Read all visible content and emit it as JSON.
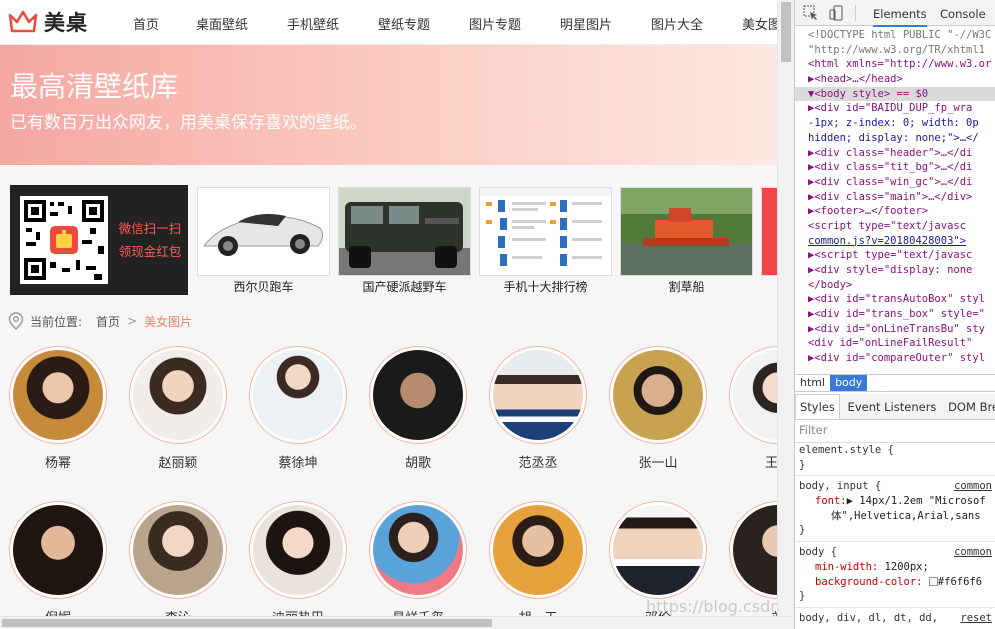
{
  "site": {
    "logo_text": "美桌",
    "nav": [
      "首页",
      "桌面壁纸",
      "手机壁纸",
      "壁纸专题",
      "图片专题",
      "明星图片",
      "图片大全",
      "美女图"
    ],
    "banner": {
      "title": "最高清壁纸库",
      "subtitle": "已有数百万出众网友，用美桌保存喜欢的壁纸。"
    },
    "promo": {
      "line1": "微信扫一扫",
      "line2": "领现金红包"
    },
    "thumbs": [
      {
        "caption": "西尔贝跑车",
        "icon": "sports-car-image"
      },
      {
        "caption": "国产硬派越野车",
        "icon": "offroad-vehicle-image"
      },
      {
        "caption": "手机十大排行榜",
        "icon": "phone-ranking-image"
      },
      {
        "caption": "割草船",
        "icon": "weed-boat-image"
      }
    ],
    "breadcrumb": {
      "label": "当前位置:",
      "home": "首页",
      "sep": ">",
      "current": "美女图片"
    },
    "celebrities": [
      {
        "name": "杨幂"
      },
      {
        "name": "赵丽颖"
      },
      {
        "name": "蔡徐坤"
      },
      {
        "name": "胡歌"
      },
      {
        "name": "范丞丞"
      },
      {
        "name": "张一山"
      },
      {
        "name": "王俊"
      }
    ],
    "celebrities_row2": [
      {
        "name": "倪妮"
      },
      {
        "name": "李沁"
      },
      {
        "name": "迪丽热巴"
      },
      {
        "name": "易烊千玺"
      },
      {
        "name": "胡一天"
      },
      {
        "name": "邓伦"
      },
      {
        "name": "刘"
      }
    ],
    "watermark": "https://blog.csdn.net/ITxiaoangzai"
  },
  "devtools": {
    "tabs": [
      "Elements",
      "Console"
    ],
    "dom_lines": [
      "<!DOCTYPE html PUBLIC \"-//W3C",
      "\"http://www.w3.org/TR/xhtml1",
      "<html xmlns=\"http://www.w3.or",
      "  ▶<head>…</head>",
      "▼<body style> == $0",
      "    ▶<div id=\"BAIDU_DUP_fp_wra",
      "    -1px; z-index: 0; width: 0p",
      "    hidden; display: none;\">…</",
      "    ▶<div class=\"header\">…</di",
      "    ▶<div class=\"tit_bg\">…</di",
      "    ▶<div class=\"win_gc\">…</di",
      "    ▶<div class=\"main\">…</div>",
      "    ▶<footer>…</footer>",
      "     <script type=\"text/javasc",
      "     common.js?v=20180428003\">",
      "    ▶<script type=\"text/javasc",
      "    ▶<div style=\"display: none",
      "   </body>",
      "  ▶<div id=\"transAutoBox\" styl",
      "  ▶<div id=\"trans_box\" style=\"",
      "  ▶<div id=\"onLineTransBu\" sty",
      "   <div id=\"onLineFailResult\"",
      "  ▶<div id=\"compareOuter\" styl"
    ],
    "breadcrumb": [
      "html",
      "body"
    ],
    "style_tabs": [
      "Styles",
      "Event Listeners",
      "DOM Breakp"
    ],
    "filter_placeholder": "Filter",
    "rules": {
      "r1_selector": "element.style {",
      "r1_close": "}",
      "r2_selector": "body, input {",
      "r2_source": "common",
      "r2_prop": "font:",
      "r2_val": "▶ 14px/1.2em \"Microsof",
      "r2_val2": "体\",Helvetica,Arial,sans",
      "r2_close": "}",
      "r3_selector": "body {",
      "r3_source": "common",
      "r3_prop1": "min-width:",
      "r3_val1": "1200px;",
      "r3_prop2": "background-color:",
      "r3_val2": "#f6f6f6",
      "r3_close": "}",
      "r4_selector": "body, div, dl, dt, dd,",
      "r4_source": "reset"
    }
  }
}
